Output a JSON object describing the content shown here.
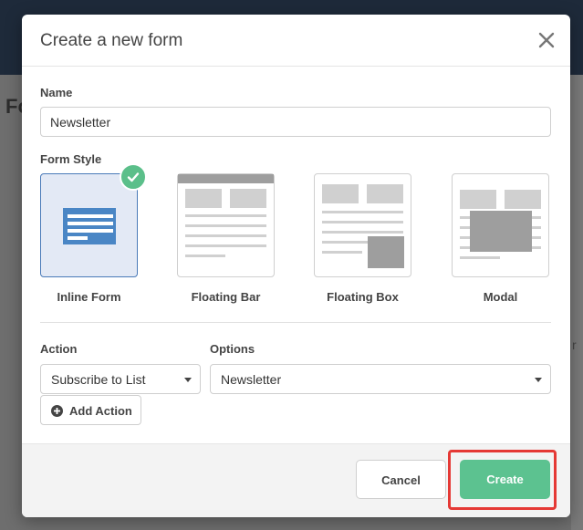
{
  "background": {
    "heading_fragment": "Fo",
    "right_fragment": "r"
  },
  "modal": {
    "title": "Create a new form",
    "close_icon": "close-icon"
  },
  "name_field": {
    "label": "Name",
    "value": "Newsletter"
  },
  "form_style": {
    "label": "Form Style",
    "selected": "Inline Form",
    "options": [
      {
        "label": "Inline Form",
        "icon": "inline-form-icon"
      },
      {
        "label": "Floating Bar",
        "icon": "floating-bar-icon"
      },
      {
        "label": "Floating Box",
        "icon": "floating-box-icon"
      },
      {
        "label": "Modal",
        "icon": "modal-icon"
      }
    ]
  },
  "action": {
    "label": "Action",
    "value": "Subscribe to List"
  },
  "options": {
    "label": "Options",
    "value": "Newsletter"
  },
  "add_action": {
    "label": "Add Action"
  },
  "footer": {
    "cancel_label": "Cancel",
    "create_label": "Create"
  },
  "colors": {
    "accent_green": "#5cc290",
    "selected_blue": "#4a7ab8",
    "highlight_red": "#e53935"
  }
}
